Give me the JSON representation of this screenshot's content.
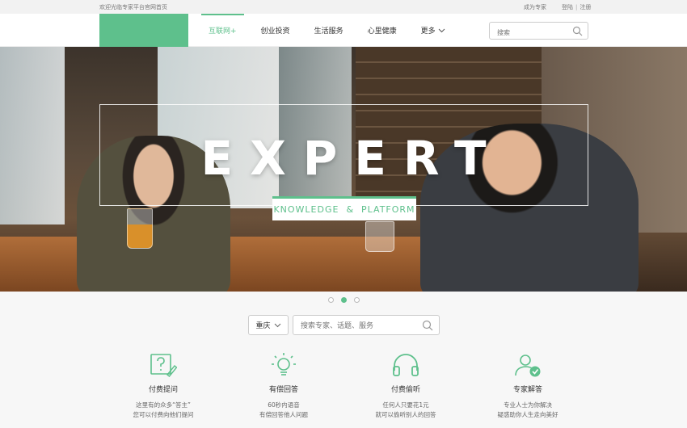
{
  "topbar": {
    "welcome": "欢迎光临专家平台官网首页",
    "become_expert": "成为专家",
    "login": "登陆",
    "register": "注册"
  },
  "nav": {
    "items": [
      {
        "label": "互联网+"
      },
      {
        "label": "创业投资"
      },
      {
        "label": "生活服务"
      },
      {
        "label": "心里健康"
      },
      {
        "label": "更多"
      }
    ],
    "search_placeholder": "搜索"
  },
  "hero": {
    "headline": "EXPERT",
    "subline": "KNOWLEDGE  &  PLATFORM"
  },
  "carousel": {
    "total": 3,
    "active_index": 1
  },
  "search": {
    "city": "重庆",
    "placeholder": "搜索专家、话题、服务"
  },
  "features": [
    {
      "icon": "question-board-icon",
      "title": "付费提问",
      "desc1": "这里有的众多“答主”",
      "desc2": "您可以付费向他们提问"
    },
    {
      "icon": "lightbulb-icon",
      "title": "有偿回答",
      "desc1": "60秒内语音",
      "desc2": "有偿回答他人问题"
    },
    {
      "icon": "headphones-icon",
      "title": "付费偷听",
      "desc1": "任何人只要花1元",
      "desc2": "就可以偷听别人的回答"
    },
    {
      "icon": "expert-verified-icon",
      "title": "专家解答",
      "desc1": "专业人士为你解决",
      "desc2": "疑惑助你人生走向美好"
    }
  ],
  "colors": {
    "accent": "#5ec08c",
    "topbar_bg": "#f2f2f2",
    "page_bg": "#f7f7f7"
  }
}
